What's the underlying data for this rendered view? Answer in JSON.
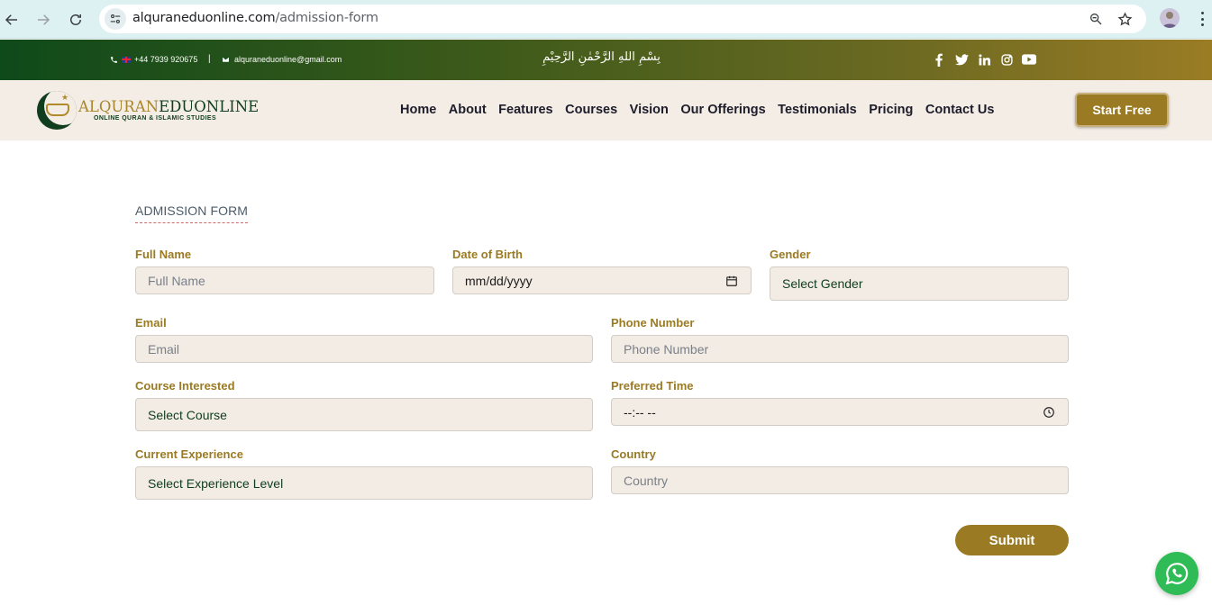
{
  "browser": {
    "url_domain": "alquraneduonline.com",
    "url_path": "/admission-form"
  },
  "topbar": {
    "phone": "+44 7939 920675",
    "separator": "|",
    "email": "alquraneduonline@gmail.com",
    "bismillah": "بِسْمِ اللهِ الرَّحْمٰنِ الرَّحِيْمِ",
    "socials": [
      "facebook-icon",
      "twitter-icon",
      "linkedin-icon",
      "instagram-icon",
      "youtube-icon"
    ]
  },
  "header": {
    "logo_title_part1": "ALQURAN",
    "logo_title_part2": "EDUONLINE",
    "logo_subtitle": "ONLINE QURAN & ISLAMIC STUDIES",
    "nav": [
      "Home",
      "About",
      "Features",
      "Courses",
      "Vision",
      "Our Offerings",
      "Testimonials",
      "Pricing",
      "Contact Us"
    ],
    "cta": "Start Free"
  },
  "form": {
    "title": "ADMISSION FORM",
    "full_name": {
      "label": "Full Name",
      "placeholder": "Full Name"
    },
    "dob": {
      "label": "Date of Birth",
      "value": "mm/dd/yyyy"
    },
    "gender": {
      "label": "Gender",
      "value": "Select Gender"
    },
    "email": {
      "label": "Email",
      "placeholder": "Email"
    },
    "phone": {
      "label": "Phone Number",
      "placeholder": "Phone Number"
    },
    "course": {
      "label": "Course Interested",
      "value": "Select Course"
    },
    "time": {
      "label": "Preferred Time",
      "value": "--:-- --"
    },
    "experience": {
      "label": "Current Experience",
      "value": "Select Experience Level"
    },
    "country": {
      "label": "Country",
      "placeholder": "Country"
    },
    "submit": "Submit"
  },
  "colors": {
    "brand_green": "#0f3d1e",
    "brand_gold": "#9a7a22",
    "field_bg": "#f3ece5",
    "whatsapp": "#2fbb55"
  }
}
